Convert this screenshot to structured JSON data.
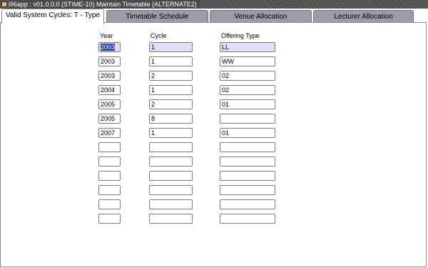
{
  "window": {
    "title": "i96app : v01.0.0.0 (STIME-10) Maintain Timetable  (ALTERNATE2)"
  },
  "tabs": [
    {
      "label": "Valid System Cycles: T - Type",
      "active": true
    },
    {
      "label": "Timetable Schedule",
      "active": false
    },
    {
      "label": "Venue Allocation",
      "active": false
    },
    {
      "label": "Lecturer Allocation",
      "active": false
    }
  ],
  "columns": {
    "year": "Year",
    "cycle": "Cycle",
    "offering_type": "Offering Type"
  },
  "rows": [
    {
      "year": "2003",
      "cycle": "1",
      "offering_type": "LL"
    },
    {
      "year": "2003",
      "cycle": "1",
      "offering_type": "WW"
    },
    {
      "year": "2003",
      "cycle": "2",
      "offering_type": "02"
    },
    {
      "year": "2004",
      "cycle": "1",
      "offering_type": "02"
    },
    {
      "year": "2005",
      "cycle": "2",
      "offering_type": "01"
    },
    {
      "year": "2005",
      "cycle": "8",
      "offering_type": ""
    },
    {
      "year": "2007",
      "cycle": "1",
      "offering_type": "01"
    },
    {
      "year": "",
      "cycle": "",
      "offering_type": ""
    },
    {
      "year": "",
      "cycle": "",
      "offering_type": ""
    },
    {
      "year": "",
      "cycle": "",
      "offering_type": ""
    },
    {
      "year": "",
      "cycle": "",
      "offering_type": ""
    },
    {
      "year": "",
      "cycle": "",
      "offering_type": ""
    },
    {
      "year": "",
      "cycle": "",
      "offering_type": ""
    }
  ],
  "colors": {
    "selection": "#1f3aa8",
    "focus_row": "#dde0f8",
    "tab_inactive": "#9a9da5"
  }
}
